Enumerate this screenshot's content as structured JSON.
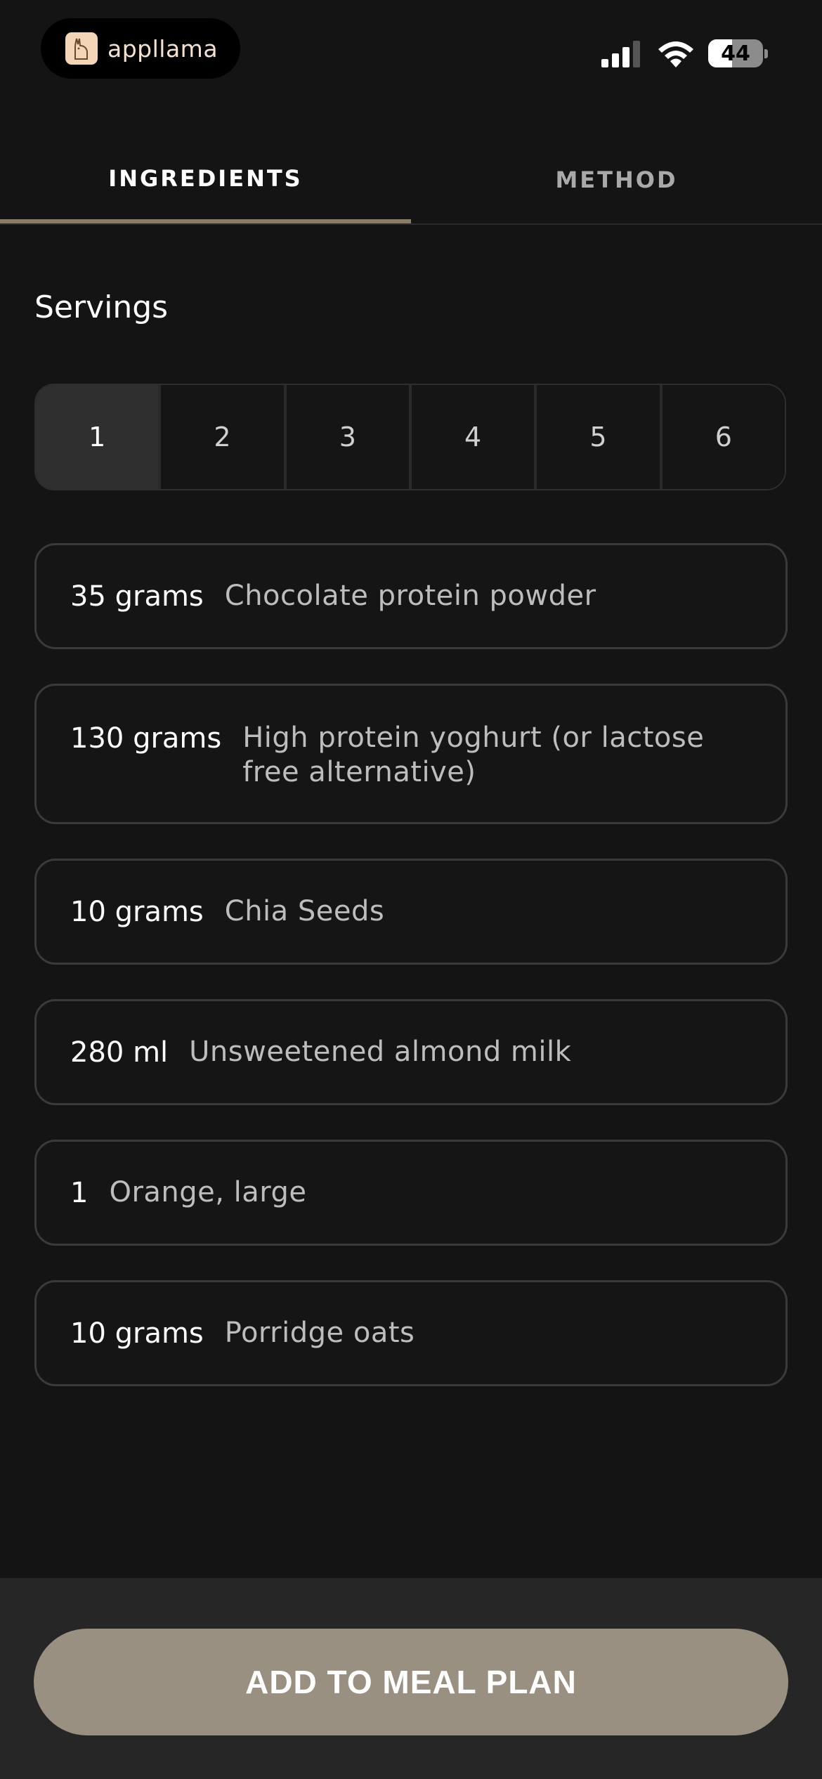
{
  "status_bar": {
    "app_name": "appllama",
    "battery": "44",
    "battery_level": 0.44
  },
  "tabs": [
    {
      "label": "INGREDIENTS",
      "active": true
    },
    {
      "label": "METHOD",
      "active": false
    }
  ],
  "servings": {
    "label": "Servings",
    "options": [
      "1",
      "2",
      "3",
      "4",
      "5",
      "6"
    ],
    "selected": "1"
  },
  "ingredients": [
    {
      "qty": "35 grams",
      "name": "Chocolate protein powder"
    },
    {
      "qty": "130 grams",
      "name": "High protein yoghurt (or lactose free alternative)"
    },
    {
      "qty": "10 grams",
      "name": "Chia Seeds"
    },
    {
      "qty": "280 ml",
      "name": "Unsweetened almond milk"
    },
    {
      "qty": "1",
      "name": "Orange, large"
    },
    {
      "qty": "10 grams",
      "name": "Porridge oats"
    }
  ],
  "cta": {
    "label": "ADD TO MEAL PLAN"
  },
  "colors": {
    "accent": "#8c7d66",
    "button": "#999082",
    "background": "#141414"
  }
}
